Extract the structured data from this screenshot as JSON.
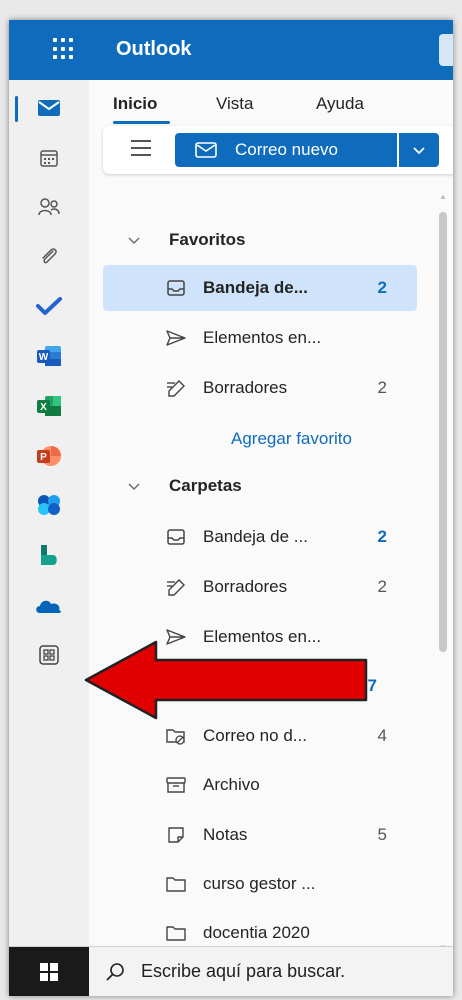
{
  "app": {
    "title": "Outlook"
  },
  "tabs": [
    "Inicio",
    "Vista",
    "Ayuda"
  ],
  "ribbon": {
    "new_mail_label": "Correo nuevo"
  },
  "rail_items": [
    "mail-icon",
    "calendar-icon",
    "people-icon",
    "attach-icon",
    "todo-icon",
    "word-icon",
    "excel-icon",
    "powerpoint-icon",
    "office-icon",
    "bookings-icon",
    "onedrive-icon",
    "apps-icon"
  ],
  "favorites": {
    "header": "Favoritos",
    "items": [
      {
        "label": "Bandeja de...",
        "count": "2"
      },
      {
        "label": "Elementos en...",
        "count": ""
      },
      {
        "label": "Borradores",
        "count": "2"
      }
    ],
    "add_link": "Agregar favorito"
  },
  "folders": {
    "header": "Carpetas",
    "items": [
      {
        "label": "Bandeja de ...",
        "count": "2"
      },
      {
        "label": "Borradores",
        "count": "2"
      },
      {
        "label": "Elementos en...",
        "count": ""
      },
      {
        "label": "",
        "count": "37"
      },
      {
        "label": "Correo no d...",
        "count": "4"
      },
      {
        "label": "Archivo",
        "count": ""
      },
      {
        "label": "Notas",
        "count": "5"
      },
      {
        "label": "curso gestor ...",
        "count": ""
      },
      {
        "label": "docentia 2020",
        "count": ""
      }
    ]
  },
  "taskbar": {
    "search_placeholder": "Escribe aquí para buscar."
  },
  "colors": {
    "brand": "#0f6cbd",
    "selected_row": "#cfe4fa",
    "arrow": "#e00000"
  }
}
